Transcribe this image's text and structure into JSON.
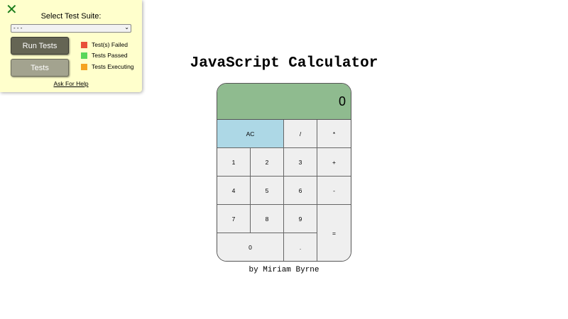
{
  "test_panel": {
    "close_icon": "✕",
    "suite_label": "Select Test Suite:",
    "suite_selected": "- - -",
    "run_tests_label": "Run Tests",
    "tests_label": "Tests",
    "legend": [
      {
        "label": "Test(s) Failed",
        "color": "#e8503a"
      },
      {
        "label": "Tests Passed",
        "color": "#5ad65a"
      },
      {
        "label": "Tests Executing",
        "color": "#f5a320"
      }
    ],
    "help_label": "Ask For Help"
  },
  "calculator": {
    "title": "JavaScript Calculator",
    "display_value": "0",
    "keys": {
      "ac": "AC",
      "divide": "/",
      "multiply": "*",
      "one": "1",
      "two": "2",
      "three": "3",
      "plus": "+",
      "four": "4",
      "five": "5",
      "six": "6",
      "minus": "-",
      "seven": "7",
      "eight": "8",
      "nine": "9",
      "equals": "=",
      "zero": "0",
      "decimal": "."
    },
    "display_color": "#8fbb8f",
    "ac_color": "#add8e6",
    "byline": "by Miriam Byrne"
  }
}
